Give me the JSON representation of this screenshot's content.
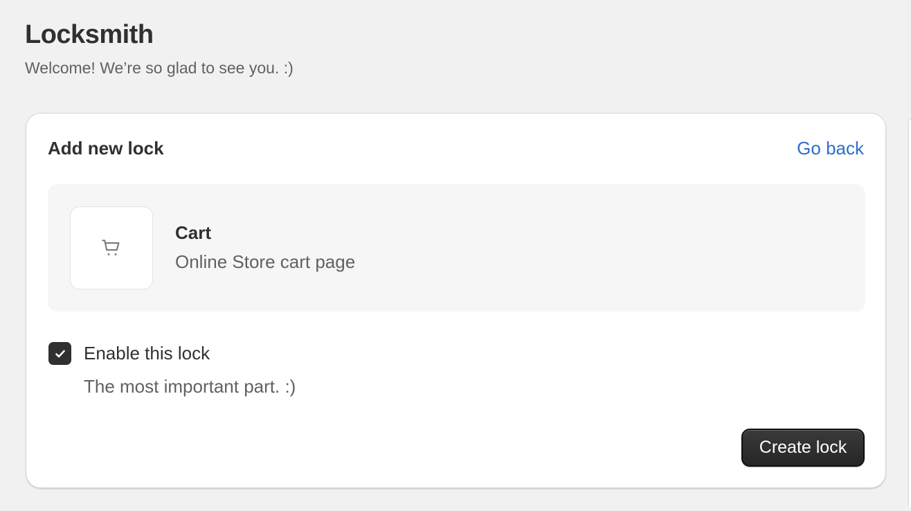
{
  "app": {
    "title": "Locksmith",
    "subtitle": "Welcome! We’re so glad to see you. :)"
  },
  "card": {
    "title": "Add new lock",
    "go_back_label": "Go back",
    "resource": {
      "icon": "cart-icon",
      "title": "Cart",
      "description": "Online Store cart page"
    },
    "enable_lock": {
      "checked": true,
      "label": "Enable this lock",
      "help_text": "The most important part. :)"
    },
    "create_button_label": "Create lock"
  },
  "colors": {
    "background": "#f1f1f1",
    "card": "#ffffff",
    "link": "#2c6ecb",
    "primary_button": "#303030",
    "text": "#303030",
    "muted_text": "#616161"
  }
}
